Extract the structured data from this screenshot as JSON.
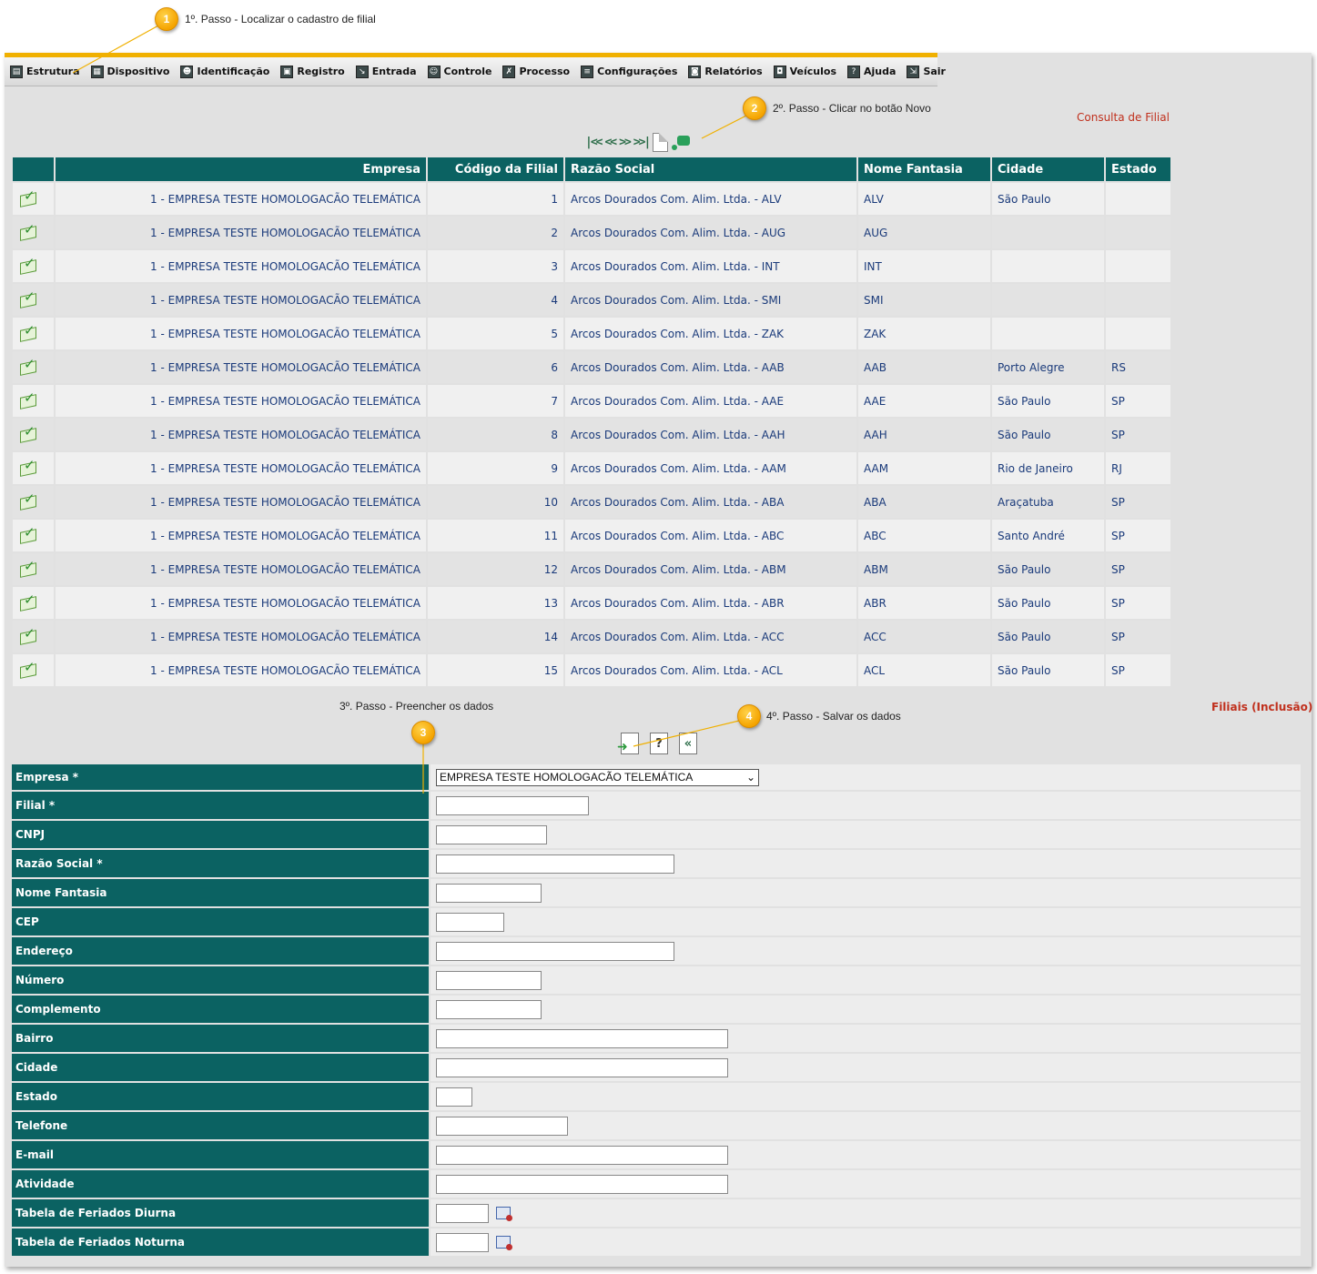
{
  "callouts": {
    "c1": {
      "num": "1",
      "text": "1º. Passo - Localizar o cadastro de filial"
    },
    "c2": {
      "num": "2",
      "text": "2º. Passo - Clicar no botão Novo"
    },
    "c3": {
      "num": "3",
      "text": "3º. Passo - Preencher os dados"
    },
    "c4": {
      "num": "4",
      "text": "4º. Passo - Salvar os dados"
    }
  },
  "menu": {
    "items": [
      {
        "label": "Estrutura"
      },
      {
        "label": "Dispositivo"
      },
      {
        "label": "Identificação"
      },
      {
        "label": "Registro"
      },
      {
        "label": "Entrada"
      },
      {
        "label": "Controle"
      },
      {
        "label": "Processo"
      },
      {
        "label": "Configurações"
      },
      {
        "label": "Relatórios"
      },
      {
        "label": "Veículos"
      },
      {
        "label": "Ajuda"
      },
      {
        "label": "Sair"
      }
    ]
  },
  "consulta": {
    "title": "Consulta de Filial",
    "nav": {
      "first": "|<<",
      "prev": "<<",
      "next": ">>",
      "last": ">>|"
    },
    "headers": {
      "empresa": "Empresa",
      "codigo": "Código da Filial",
      "razao": "Razão Social",
      "fantasia": "Nome Fantasia",
      "cidade": "Cidade",
      "estado": "Estado"
    },
    "rows": [
      {
        "empresa": "1 - EMPRESA TESTE HOMOLOGACÃO TELEMÁTICA",
        "codigo": "1",
        "razao": "Arcos Dourados Com. Alim. Ltda. - ALV",
        "fantasia": "ALV",
        "cidade": "São Paulo",
        "estado": ""
      },
      {
        "empresa": "1 - EMPRESA TESTE HOMOLOGACÃO TELEMÁTICA",
        "codigo": "2",
        "razao": "Arcos Dourados Com. Alim. Ltda. - AUG",
        "fantasia": "AUG",
        "cidade": "",
        "estado": ""
      },
      {
        "empresa": "1 - EMPRESA TESTE HOMOLOGACÃO TELEMÁTICA",
        "codigo": "3",
        "razao": "Arcos Dourados Com. Alim. Ltda. - INT",
        "fantasia": "INT",
        "cidade": "",
        "estado": ""
      },
      {
        "empresa": "1 - EMPRESA TESTE HOMOLOGACÃO TELEMÁTICA",
        "codigo": "4",
        "razao": "Arcos Dourados Com. Alim. Ltda. - SMI",
        "fantasia": "SMI",
        "cidade": "",
        "estado": ""
      },
      {
        "empresa": "1 - EMPRESA TESTE HOMOLOGACÃO TELEMÁTICA",
        "codigo": "5",
        "razao": "Arcos Dourados Com. Alim. Ltda. - ZAK",
        "fantasia": "ZAK",
        "cidade": "",
        "estado": ""
      },
      {
        "empresa": "1 - EMPRESA TESTE HOMOLOGACÃO TELEMÁTICA",
        "codigo": "6",
        "razao": "Arcos Dourados Com. Alim. Ltda. - AAB",
        "fantasia": "AAB",
        "cidade": "Porto Alegre",
        "estado": "RS"
      },
      {
        "empresa": "1 - EMPRESA TESTE HOMOLOGACÃO TELEMÁTICA",
        "codigo": "7",
        "razao": "Arcos Dourados Com. Alim. Ltda. - AAE",
        "fantasia": "AAE",
        "cidade": "São Paulo",
        "estado": "SP"
      },
      {
        "empresa": "1 - EMPRESA TESTE HOMOLOGACÃO TELEMÁTICA",
        "codigo": "8",
        "razao": "Arcos Dourados Com. Alim. Ltda. - AAH",
        "fantasia": "AAH",
        "cidade": "São Paulo",
        "estado": "SP"
      },
      {
        "empresa": "1 - EMPRESA TESTE HOMOLOGACÃO TELEMÁTICA",
        "codigo": "9",
        "razao": "Arcos Dourados Com. Alim. Ltda. - AAM",
        "fantasia": "AAM",
        "cidade": "Rio de Janeiro",
        "estado": "RJ"
      },
      {
        "empresa": "1 - EMPRESA TESTE HOMOLOGACÃO TELEMÁTICA",
        "codigo": "10",
        "razao": "Arcos Dourados Com. Alim. Ltda. - ABA",
        "fantasia": "ABA",
        "cidade": "Araçatuba",
        "estado": "SP"
      },
      {
        "empresa": "1 - EMPRESA TESTE HOMOLOGACÃO TELEMÁTICA",
        "codigo": "11",
        "razao": "Arcos Dourados Com. Alim. Ltda. - ABC",
        "fantasia": "ABC",
        "cidade": "Santo André",
        "estado": "SP"
      },
      {
        "empresa": "1 - EMPRESA TESTE HOMOLOGACÃO TELEMÁTICA",
        "codigo": "12",
        "razao": "Arcos Dourados Com. Alim. Ltda. - ABM",
        "fantasia": "ABM",
        "cidade": "São Paulo",
        "estado": "SP"
      },
      {
        "empresa": "1 - EMPRESA TESTE HOMOLOGACÃO TELEMÁTICA",
        "codigo": "13",
        "razao": "Arcos Dourados Com. Alim. Ltda. - ABR",
        "fantasia": "ABR",
        "cidade": "São Paulo",
        "estado": "SP"
      },
      {
        "empresa": "1 - EMPRESA TESTE HOMOLOGACÃO TELEMÁTICA",
        "codigo": "14",
        "razao": "Arcos Dourados Com. Alim. Ltda. - ACC",
        "fantasia": "ACC",
        "cidade": "São Paulo",
        "estado": "SP"
      },
      {
        "empresa": "1 - EMPRESA TESTE HOMOLOGACÃO TELEMÁTICA",
        "codigo": "15",
        "razao": "Arcos Dourados Com. Alim. Ltda. - ACL",
        "fantasia": "ACL",
        "cidade": "São Paulo",
        "estado": "SP"
      }
    ]
  },
  "inclusao": {
    "title": "Filiais (Inclusão)",
    "help_label": "?",
    "fields": {
      "empresa": {
        "label": "Empresa *",
        "value": "EMPRESA TESTE HOMOLOGACÃO TELEMÁTICA"
      },
      "filial": {
        "label": "Filial *"
      },
      "cnpj": {
        "label": "CNPJ"
      },
      "razao": {
        "label": "Razão Social *"
      },
      "fantasia": {
        "label": "Nome Fantasia"
      },
      "cep": {
        "label": "CEP"
      },
      "endereco": {
        "label": "Endereço"
      },
      "numero": {
        "label": "Número"
      },
      "complemento": {
        "label": "Complemento"
      },
      "bairro": {
        "label": "Bairro"
      },
      "cidade": {
        "label": "Cidade"
      },
      "estado": {
        "label": "Estado"
      },
      "telefone": {
        "label": "Telefone"
      },
      "email": {
        "label": "E-mail"
      },
      "atividade": {
        "label": "Atividade"
      },
      "feriados_diurna": {
        "label": "Tabela de Feriados Diurna"
      },
      "feriados_noturna": {
        "label": "Tabela de Feriados Noturna"
      }
    }
  }
}
